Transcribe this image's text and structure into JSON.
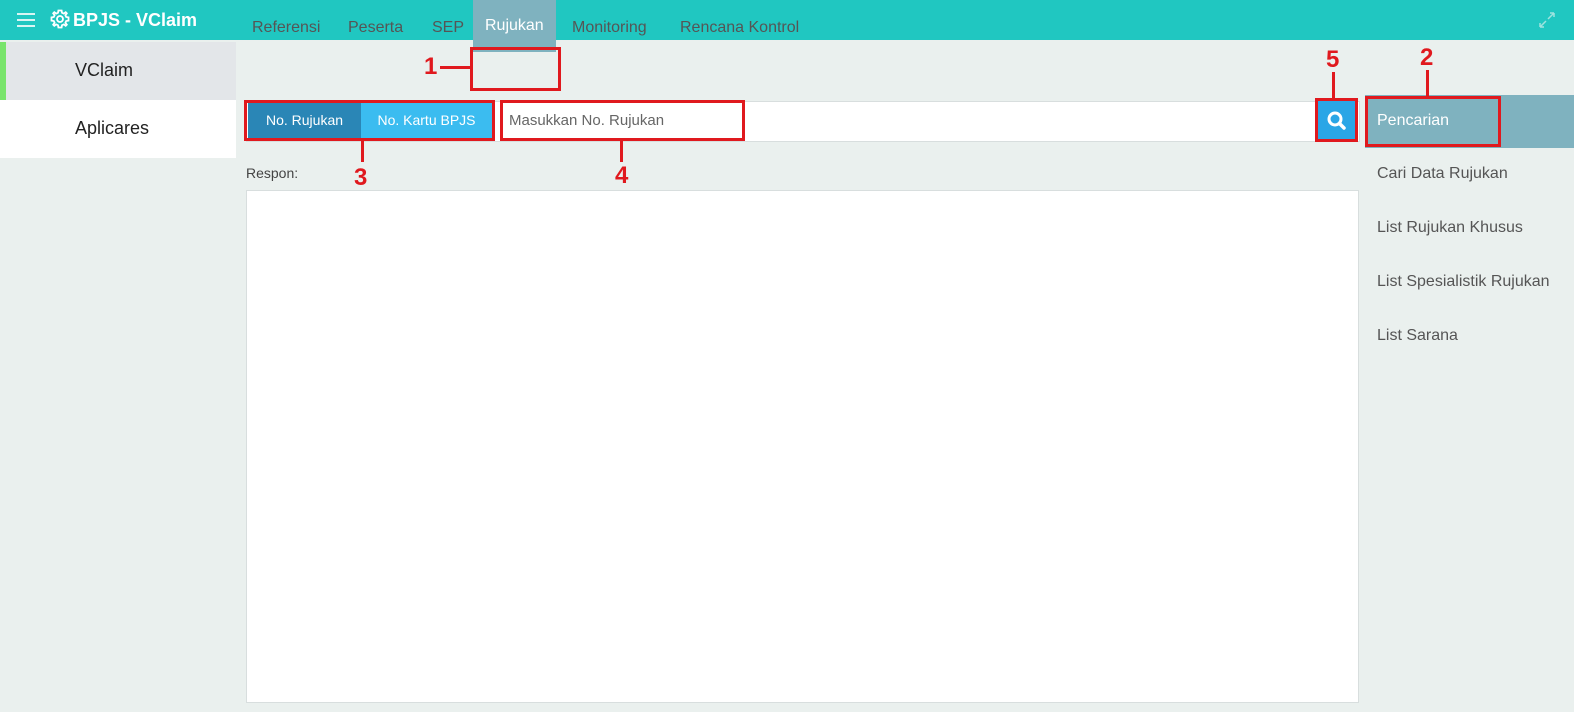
{
  "app": {
    "title": "BPJS - VClaim"
  },
  "sidebar": {
    "items": [
      {
        "label": "VClaim",
        "active": true
      },
      {
        "label": "Aplicares",
        "active": false
      }
    ]
  },
  "tabs": [
    {
      "label": "Referensi"
    },
    {
      "label": "Peserta"
    },
    {
      "label": "SEP"
    },
    {
      "label": "Rujukan",
      "active": true
    },
    {
      "label": "Monitoring"
    },
    {
      "label": "Rencana Kontrol"
    }
  ],
  "search": {
    "toggle": [
      {
        "label": "No. Rujukan",
        "active": true
      },
      {
        "label": "No. Kartu BPJS",
        "active": false
      }
    ],
    "placeholder": "Masukkan No. Rujukan",
    "value": ""
  },
  "respon": {
    "label": "Respon:"
  },
  "right_panel": {
    "header": "Pencarian",
    "links": [
      "Cari Data Rujukan",
      "List Rujukan Khusus",
      "List Spesialistik Rujukan",
      "List Sarana"
    ]
  },
  "annotations": [
    "1",
    "2",
    "3",
    "4",
    "5"
  ],
  "colors": {
    "topbar": "#20c7c1",
    "active_tab": "#7fb2bf",
    "toggle_active": "#2a86b6",
    "toggle_inactive": "#3bbcf0",
    "search_button": "#2aa6e6",
    "annotation": "#e0191e"
  }
}
